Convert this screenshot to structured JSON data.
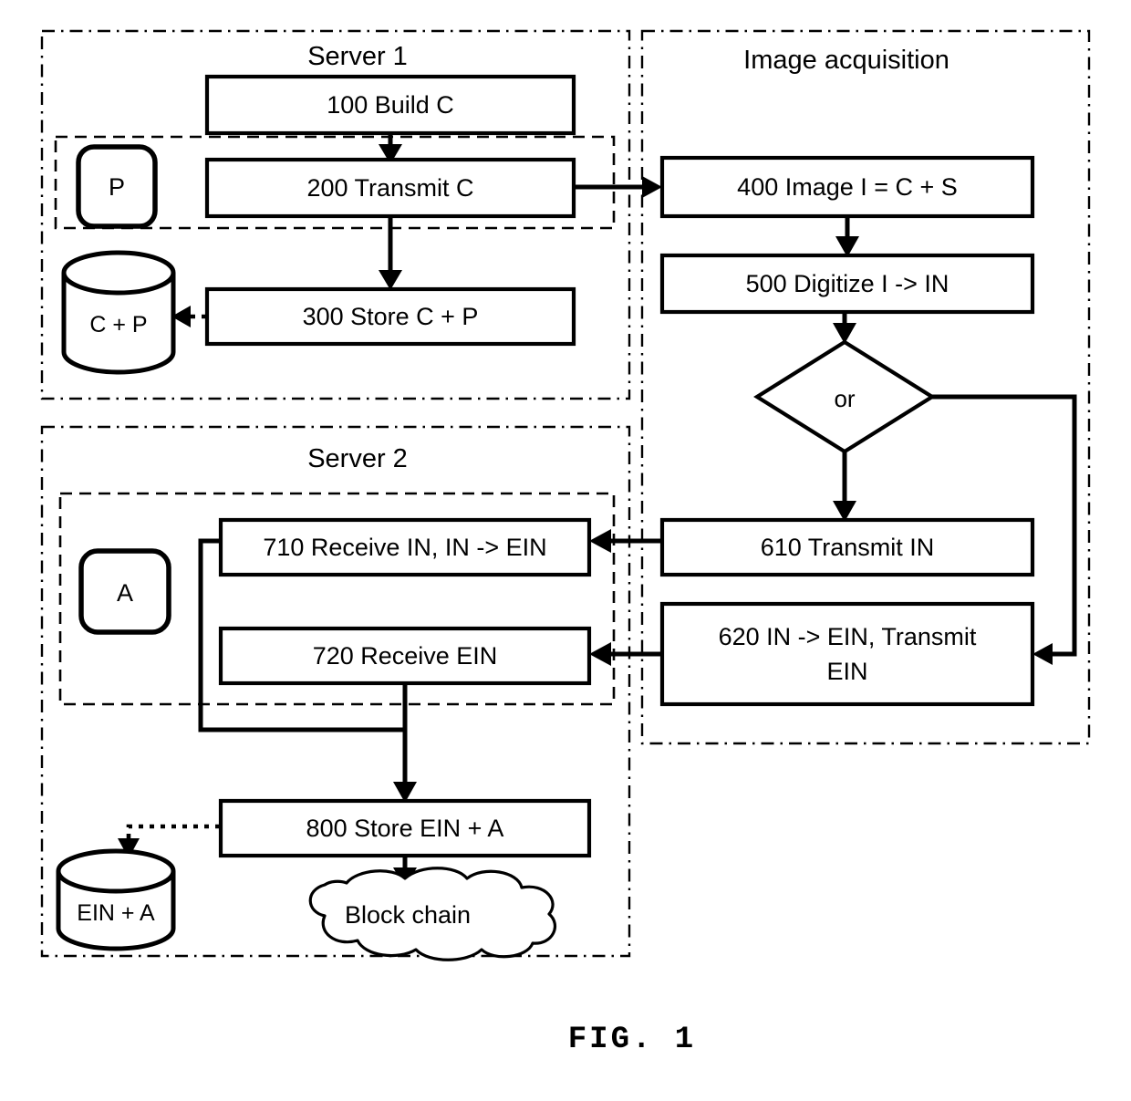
{
  "figure": {
    "caption": "FIG. 1",
    "ink_color": "#000000",
    "background_color": "#ffffff"
  },
  "groups": {
    "server1": {
      "title": "Server 1"
    },
    "server2": {
      "title": "Server 2"
    },
    "image_acquisition": {
      "title": "Image acquisition"
    }
  },
  "server1": {
    "steps": [
      {
        "id": "100",
        "label": "100 Build C"
      },
      {
        "id": "200",
        "label": "200 Transmit C"
      },
      {
        "id": "300",
        "label": "300 Store C + P"
      }
    ],
    "token": {
      "label": "P"
    },
    "datastore": {
      "label": "C + P"
    }
  },
  "image_acquisition": {
    "steps": [
      {
        "id": "400",
        "label": "400 Image I = C + S"
      },
      {
        "id": "500",
        "label": "500 Digitize I -> IN"
      },
      {
        "id": "610",
        "label": "610 Transmit IN"
      }
    ],
    "decision": {
      "label": "or"
    },
    "step620": {
      "line1": "620 IN -> EIN, Transmit",
      "line2": "EIN"
    }
  },
  "server2": {
    "steps": [
      {
        "id": "710",
        "label": "710 Receive IN, IN -> EIN"
      },
      {
        "id": "720",
        "label": "720 Receive EIN"
      },
      {
        "id": "800",
        "label": "800 Store EIN + A"
      }
    ],
    "token": {
      "label": "A"
    },
    "datastore": {
      "label": "EIN + A"
    },
    "network": {
      "label": "Block chain"
    }
  }
}
